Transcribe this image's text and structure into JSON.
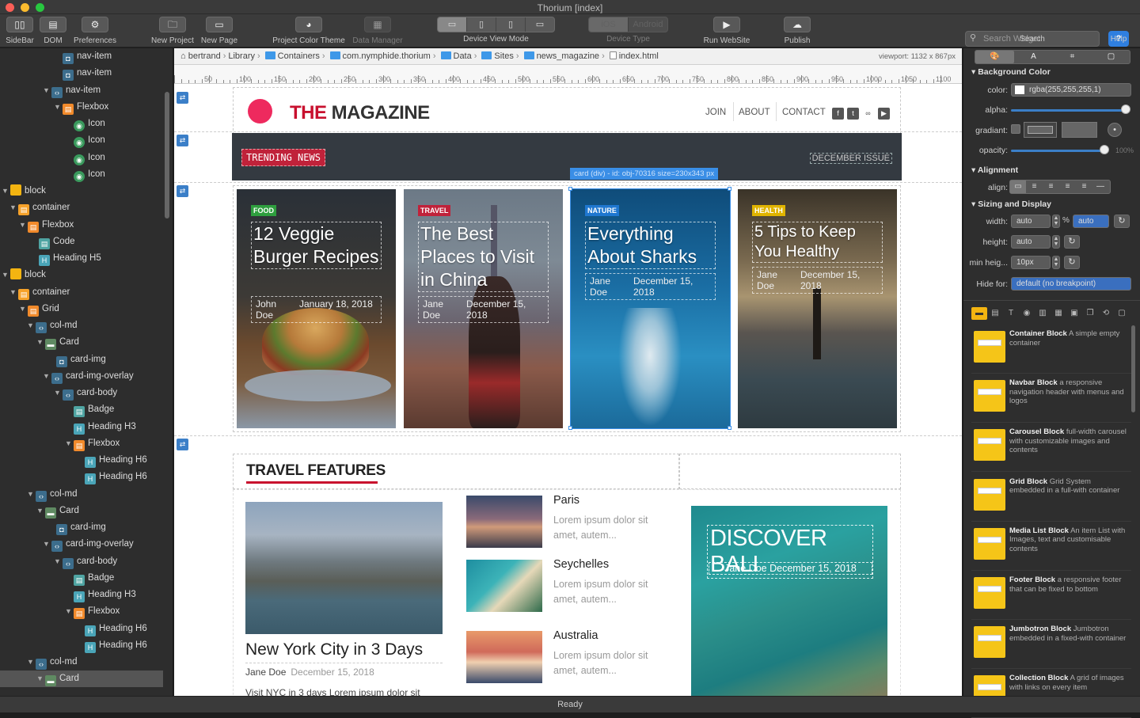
{
  "window": {
    "title": "Thorium  [index]"
  },
  "toolbar": {
    "sidebar": "SideBar",
    "dom": "DOM",
    "preferences": "Preferences",
    "new_project": "New Project",
    "new_page": "New Page",
    "color_theme": "Project Color Theme",
    "data_manager": "Data Manager",
    "device_view_mode": "Device View Mode",
    "ios": "iOS",
    "android": "Android",
    "device_type": "Device Type",
    "run_website": "Run WebSite",
    "publish": "Publish",
    "search_placeholder": "Search Widget",
    "search": "Search",
    "help": "Help"
  },
  "tree": [
    {
      "label": "nav-item",
      "icon": "tag",
      "arrow": ""
    },
    {
      "label": "nav-item",
      "icon": "tag",
      "arrow": ""
    },
    {
      "label": "nav-item",
      "icon": "code",
      "arrow": "▼"
    },
    {
      "label": "Flexbox",
      "icon": "flex",
      "arrow": "▼"
    },
    {
      "label": "Icon",
      "icon": "icon",
      "arrow": ""
    },
    {
      "label": "Icon",
      "icon": "icon",
      "arrow": ""
    },
    {
      "label": "Icon",
      "icon": "icon",
      "arrow": ""
    },
    {
      "label": "Icon",
      "icon": "icon",
      "arrow": ""
    },
    {
      "label": "block",
      "icon": "block",
      "arrow": "▼"
    },
    {
      "label": "container",
      "icon": "container",
      "arrow": "▼"
    },
    {
      "label": "Flexbox",
      "icon": "flex",
      "arrow": "▼"
    },
    {
      "label": "Code",
      "icon": "codeblk",
      "arrow": ""
    },
    {
      "label": "Heading H5",
      "icon": "heading",
      "arrow": ""
    },
    {
      "label": "block",
      "icon": "block",
      "arrow": "▼"
    },
    {
      "label": "container",
      "icon": "container",
      "arrow": "▼"
    },
    {
      "label": "Grid",
      "icon": "flex",
      "arrow": "▼"
    },
    {
      "label": "col-md",
      "icon": "code",
      "arrow": "▼"
    },
    {
      "label": "Card",
      "icon": "card",
      "arrow": "▼"
    },
    {
      "label": "card-img",
      "icon": "tag",
      "arrow": ""
    },
    {
      "label": "card-img-overlay",
      "icon": "code",
      "arrow": "▼"
    },
    {
      "label": "card-body",
      "icon": "code",
      "arrow": "▼"
    },
    {
      "label": "Badge",
      "icon": "codeblk",
      "arrow": ""
    },
    {
      "label": "Heading H3",
      "icon": "heading",
      "arrow": ""
    },
    {
      "label": "Flexbox",
      "icon": "flex",
      "arrow": "▼"
    },
    {
      "label": "Heading H6",
      "icon": "heading",
      "arrow": ""
    },
    {
      "label": "Heading H6",
      "icon": "heading",
      "arrow": ""
    },
    {
      "label": "col-md",
      "icon": "code",
      "arrow": "▼"
    },
    {
      "label": "Card",
      "icon": "card",
      "arrow": "▼"
    },
    {
      "label": "card-img",
      "icon": "tag",
      "arrow": ""
    },
    {
      "label": "card-img-overlay",
      "icon": "code",
      "arrow": "▼"
    },
    {
      "label": "card-body",
      "icon": "code",
      "arrow": "▼"
    },
    {
      "label": "Badge",
      "icon": "codeblk",
      "arrow": ""
    },
    {
      "label": "Heading H3",
      "icon": "heading",
      "arrow": ""
    },
    {
      "label": "Flexbox",
      "icon": "flex",
      "arrow": "▼"
    },
    {
      "label": "Heading H6",
      "icon": "heading",
      "arrow": ""
    },
    {
      "label": "Heading H6",
      "icon": "heading",
      "arrow": ""
    },
    {
      "label": "col-md",
      "icon": "code",
      "arrow": "▼"
    },
    {
      "label": "Card",
      "icon": "card",
      "arrow": "▼",
      "selected": true
    }
  ],
  "breadcrumb": [
    "bertrand",
    "Library",
    "Containers",
    "com.nymphide.thorium",
    "Data",
    "Sites",
    "news_magazine",
    "index.html"
  ],
  "viewport": "viewport: 1132 x 867px",
  "ruler": [
    50,
    100,
    150,
    200,
    250,
    300,
    350,
    400,
    450,
    500,
    550,
    600,
    650,
    700,
    750,
    800,
    850,
    900,
    950,
    1000,
    1050,
    1100
  ],
  "page": {
    "brand_the": "THE",
    "brand_mag": "MAGAZINE",
    "nav": [
      "JOIN",
      "ABOUT",
      "CONTACT"
    ],
    "trending": "TRENDING NEWS",
    "issue": "DECEMBER ISSUE",
    "selection_tag": "card (div) - id: obj-70316 size=230x343 px",
    "cards": [
      {
        "badge": "FOOD",
        "title": "12 Veggie Burger Recipes",
        "author": "John Doe",
        "date": "January 18, 2018"
      },
      {
        "badge": "TRAVEL",
        "title": "The Best Places to Visit in China",
        "author": "Jane Doe",
        "date": "December 15, 2018"
      },
      {
        "badge": "NATURE",
        "title": "Everything About Sharks",
        "author": "Jane Doe",
        "date": "December 15, 2018"
      },
      {
        "badge": "HEALTH",
        "title": "5 Tips to Keep You Healthy",
        "author": "Jane Doe",
        "date": "December 15, 2018"
      }
    ],
    "travel_title": "TRAVEL FEATURES",
    "nyc_title": "New York City in 3 Days",
    "nyc_author": "Jane Doe",
    "nyc_date": "December 15, 2018",
    "nyc_excerpt": "Visit NYC in 3 days Lorem ipsum dolor sit",
    "media": [
      {
        "title": "Paris",
        "text": "Lorem ipsum dolor sit amet, autem..."
      },
      {
        "title": "Seychelles",
        "text": "Lorem ipsum dolor sit amet, autem..."
      },
      {
        "title": "Australia",
        "text": "Lorem ipsum dolor sit amet, autem..."
      }
    ],
    "bali_title": "DISCOVER BALI",
    "bali_meta": "Jane Doe  December 15, 2018"
  },
  "inspector": {
    "bg_section": "Background Color",
    "color_label": "color:",
    "color_value": "rgba(255,255,255,1)",
    "alpha_label": "alpha:",
    "alpha_value": 1.0,
    "gradient_label": "gradiant:",
    "opacity_label": "opacity:",
    "opacity_value": 1.0,
    "opacity_text": "100%",
    "align_section": "Alignment",
    "align_label": "align:",
    "sizing_section": "Sizing and Display",
    "width_label": "width:",
    "width_value": "auto",
    "width_unit": "%",
    "width_unit2": "auto",
    "height_label": "height:",
    "height_value": "auto",
    "minh_label": "min heig...",
    "minh_value": "10px",
    "hide_label": "Hide for:",
    "hide_value": "default (no breakpoint)"
  },
  "widgets": [
    {
      "name": "Container Block",
      "desc": "A simple empty container"
    },
    {
      "name": "Navbar Block",
      "desc": "a responsive navigation header with menus and logos"
    },
    {
      "name": "Carousel Block",
      "desc": "full-width carousel with customizable images and contents"
    },
    {
      "name": "Grid Block",
      "desc": "Grid System embedded in a full-with container"
    },
    {
      "name": "Media List Block",
      "desc": "An item List with Images, text and customisable contents"
    },
    {
      "name": "Footer Block",
      "desc": "a responsive footer that can be fixed to bottom"
    },
    {
      "name": "Jumbotron Block",
      "desc": "Jumbotron embedded in a fixed-with container"
    },
    {
      "name": "Collection Block",
      "desc": "A grid of images with links on every item"
    }
  ],
  "status": "Ready",
  "colors": {
    "accent": "#c8102e",
    "logo": "#ee2a5e",
    "selection": "#3a8ee6",
    "widget": "#f5c518"
  }
}
